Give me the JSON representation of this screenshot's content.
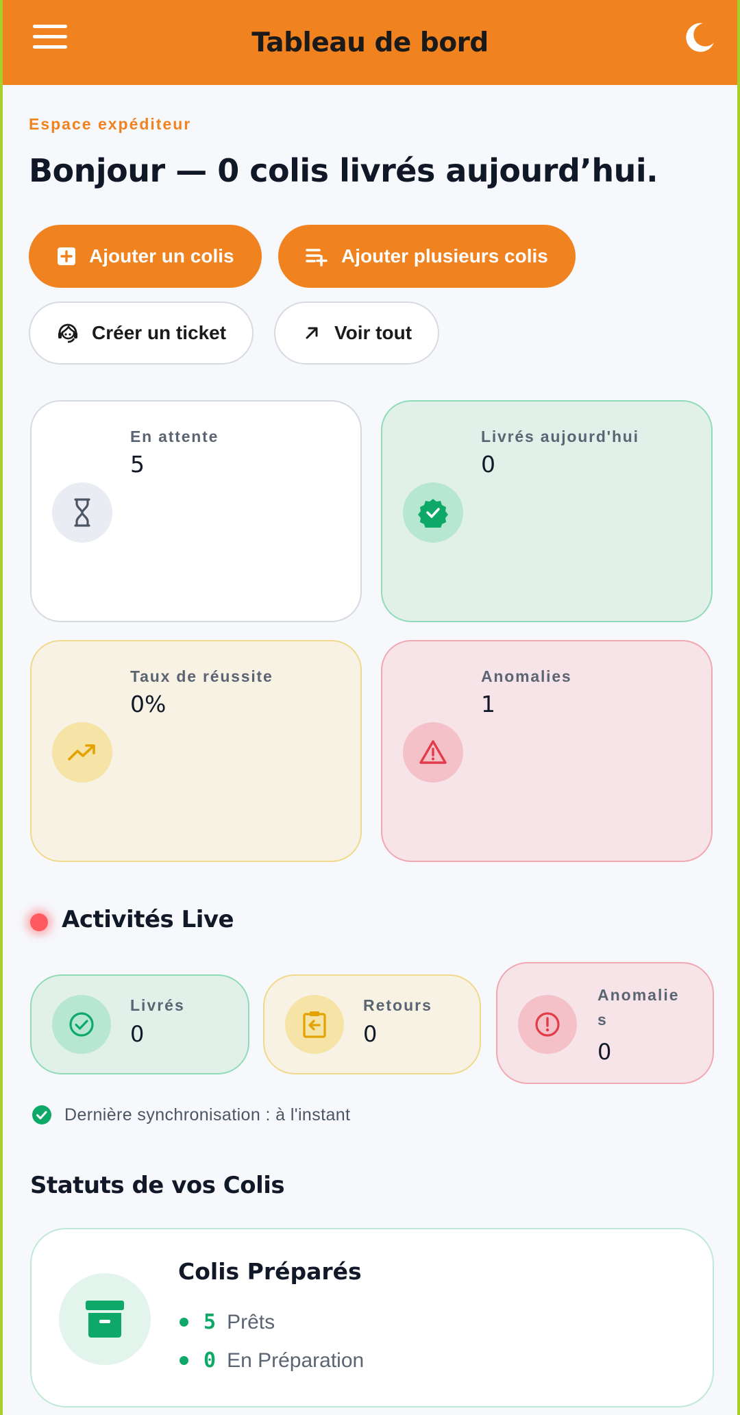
{
  "header": {
    "title": "Tableau de bord",
    "menu_icon": "menu-icon",
    "theme_icon": "moon-icon"
  },
  "hero": {
    "eyebrow": "Espace expéditeur",
    "headline": "Bonjour — 0 colis livrés aujourd’hui."
  },
  "actions": {
    "add_one": "Ajouter un colis",
    "add_many": "Ajouter plusieurs colis",
    "ticket": "Créer un ticket",
    "see_all": "Voir tout"
  },
  "stats": [
    {
      "label": "En attente",
      "value": "5",
      "icon": "hourglass-icon",
      "bg": "#ffffff",
      "border": "#d5d9e0",
      "icon_bg": "#e9edf3",
      "icon_color": "#4b5563"
    },
    {
      "label": "Livrés aujourd'hui",
      "value": "0",
      "icon": "verified-badge-icon",
      "bg": "#e1f1ea",
      "border": "#8fdbb8",
      "icon_bg": "#b7e6d1",
      "icon_color": "#0ea968"
    },
    {
      "label": "Taux de réussite",
      "value": "0%",
      "icon": "trending-up-icon",
      "bg": "#f7f2e3",
      "border": "#f1d98a",
      "icon_bg": "#f6e3a6",
      "icon_color": "#e2a300"
    },
    {
      "label": "Anomalies",
      "value": "1",
      "icon": "warning-triangle-icon",
      "bg": "#f7e4e8",
      "border": "#efa8b1",
      "icon_bg": "#f4c1c8",
      "icon_color": "#e23b49"
    }
  ],
  "live": {
    "title": "Activités Live",
    "cards": [
      {
        "label": "Livrés",
        "value": "0",
        "icon": "check-circle-icon"
      },
      {
        "label": "Retours",
        "value": "0",
        "icon": "return-clipboard-icon"
      },
      {
        "label": "Anomalie\ns",
        "value": "0",
        "icon": "alert-circle-icon"
      }
    ],
    "sync": "Dernière synchronisation : à l'instant"
  },
  "statuses": {
    "title": "Statuts de vos Colis",
    "card": {
      "title": "Colis Préparés",
      "icon": "archive-box-icon",
      "lines": [
        {
          "count": "5",
          "label": "Prêts"
        },
        {
          "count": "0",
          "label": "En Préparation"
        }
      ]
    }
  }
}
